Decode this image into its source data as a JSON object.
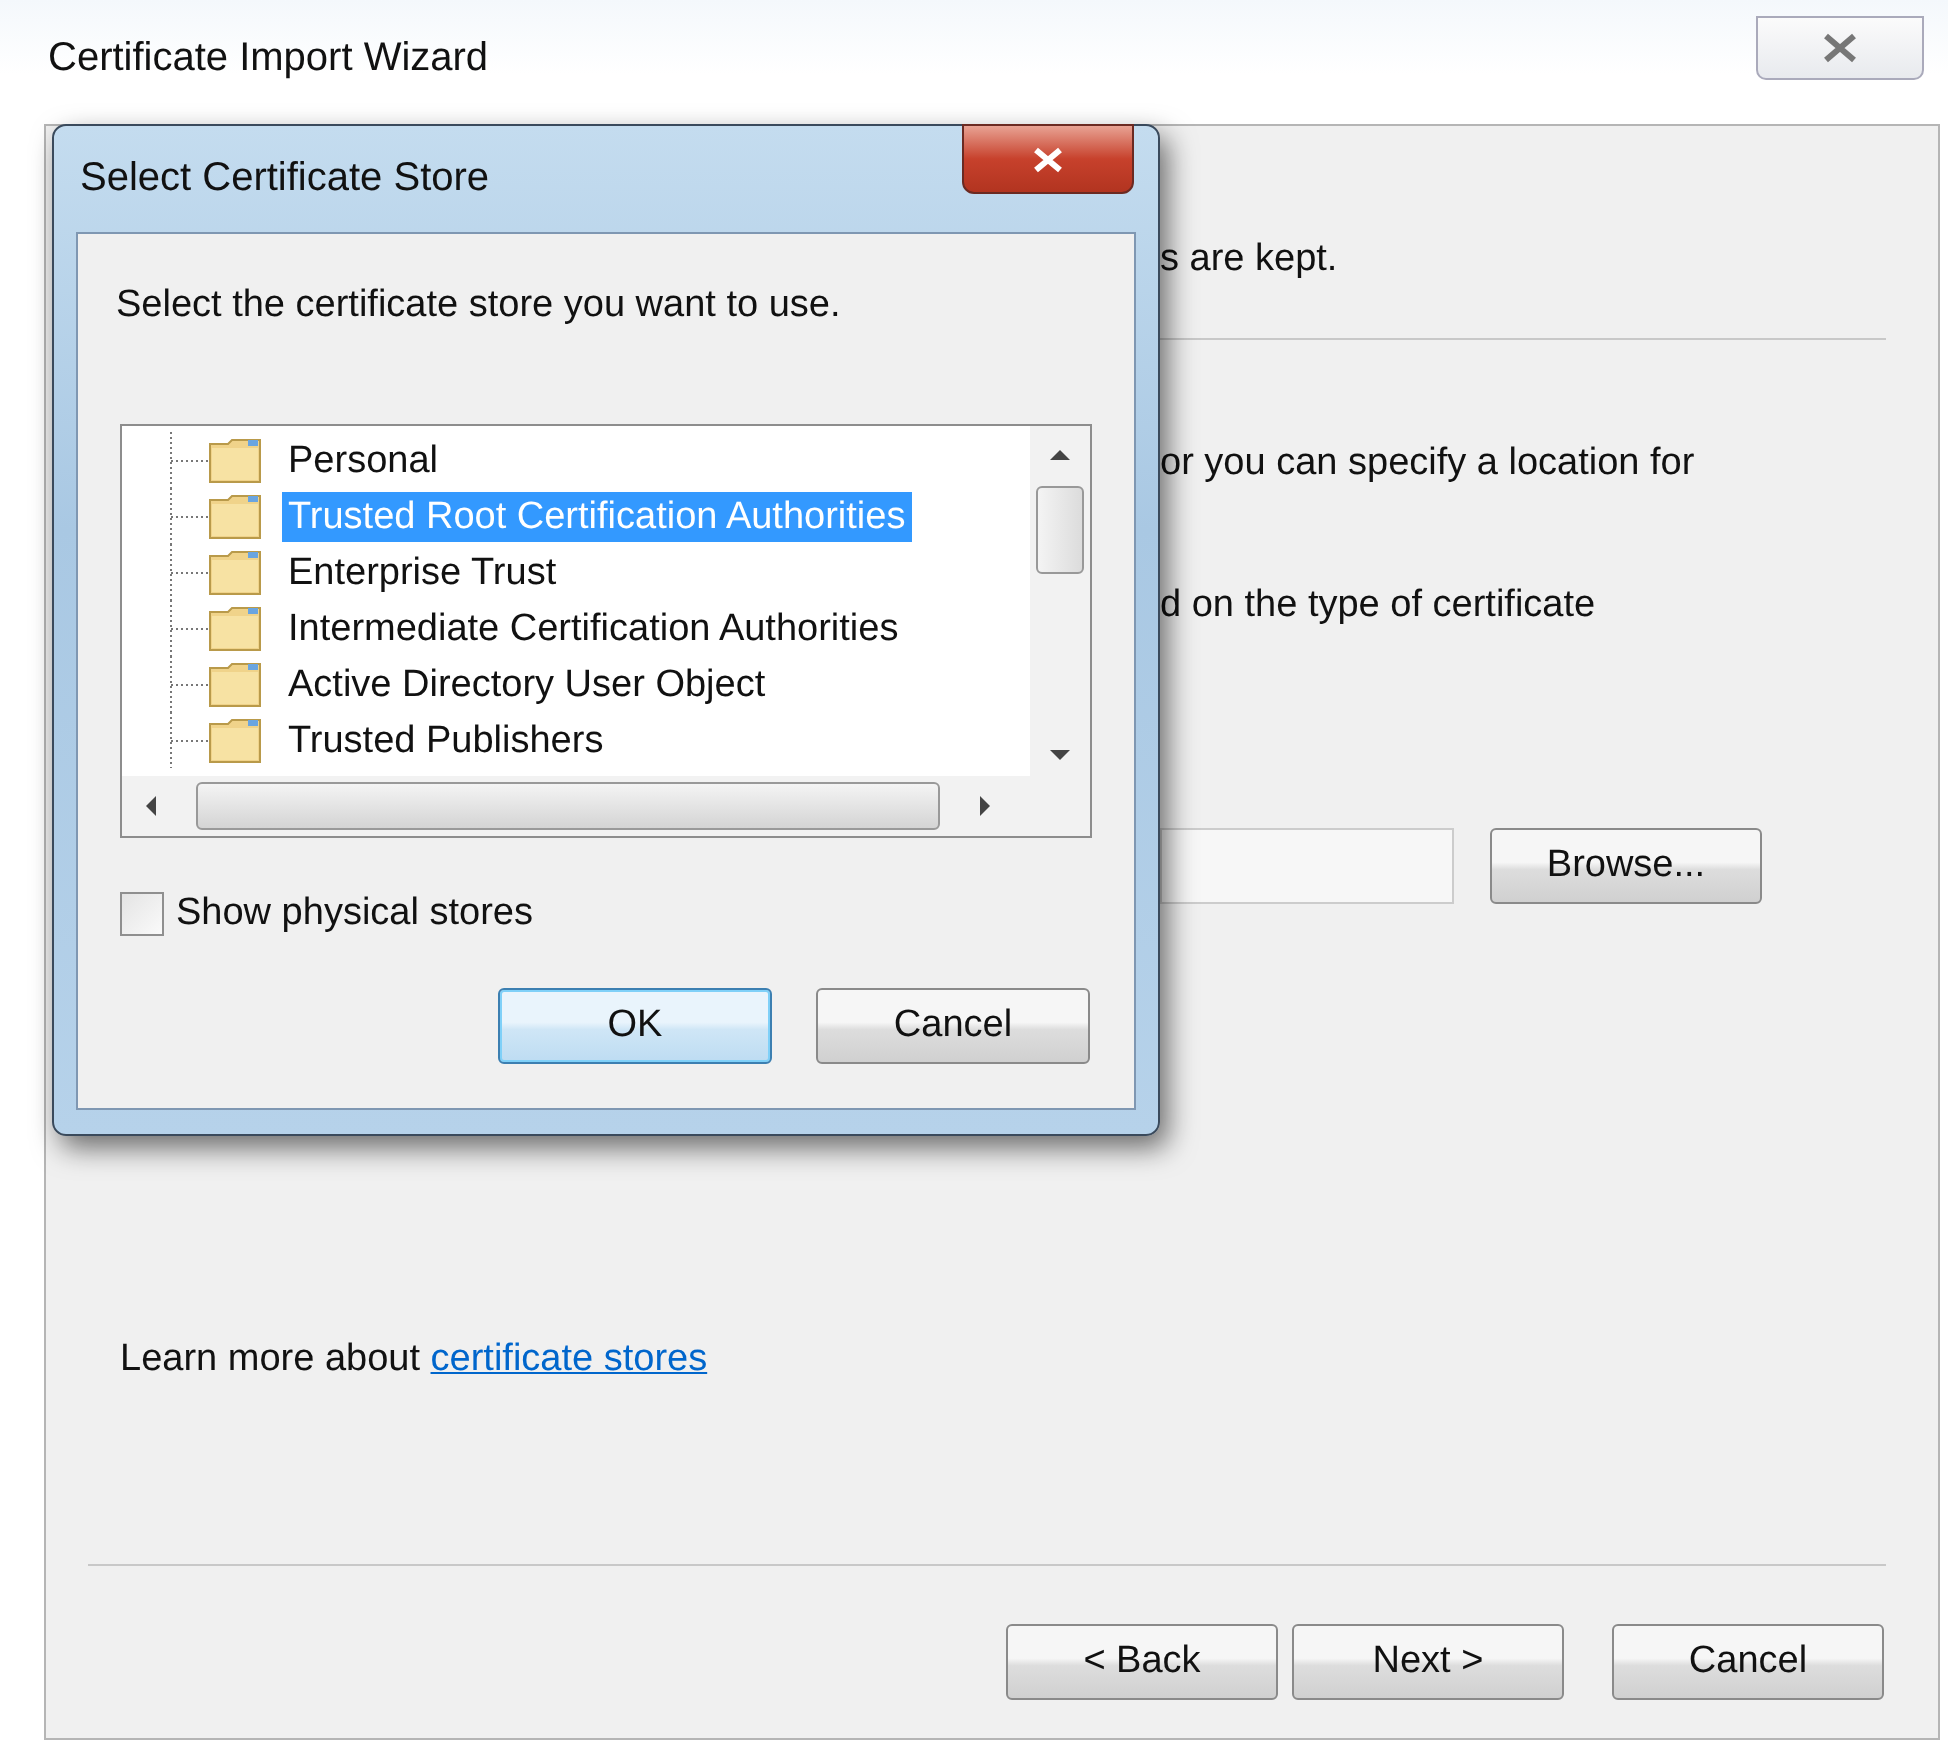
{
  "wizard": {
    "title": "Certificate Import Wizard",
    "text_fragments": [
      "s are kept.",
      "or you can specify a location for",
      "d on the type of certificate"
    ],
    "browse_button": "Browse...",
    "learn_more": {
      "text": "Learn more about",
      "link": "certificate stores"
    },
    "buttons": [
      {
        "label": "< Back",
        "focused": false
      },
      {
        "label": "Next >",
        "focused": false
      },
      {
        "label": "Cancel",
        "focused": false
      }
    ]
  },
  "dialog": {
    "title": "Select Certificate Store",
    "prompt": "Select the certificate store you want to use.",
    "stores": [
      {
        "label": "Personal",
        "selected": false
      },
      {
        "label": "Trusted Root Certification Authorities",
        "selected": true
      },
      {
        "label": "Enterprise Trust",
        "selected": false
      },
      {
        "label": "Intermediate Certification Authorities",
        "selected": false
      },
      {
        "label": "Active Directory User Object",
        "selected": false
      },
      {
        "label": "Trusted Publishers",
        "selected": false
      }
    ],
    "show_physical_stores": {
      "label": "Show physical stores",
      "checked": false
    },
    "buttons": [
      {
        "label": "OK",
        "focused": true
      },
      {
        "label": "Cancel",
        "focused": false
      }
    ]
  }
}
